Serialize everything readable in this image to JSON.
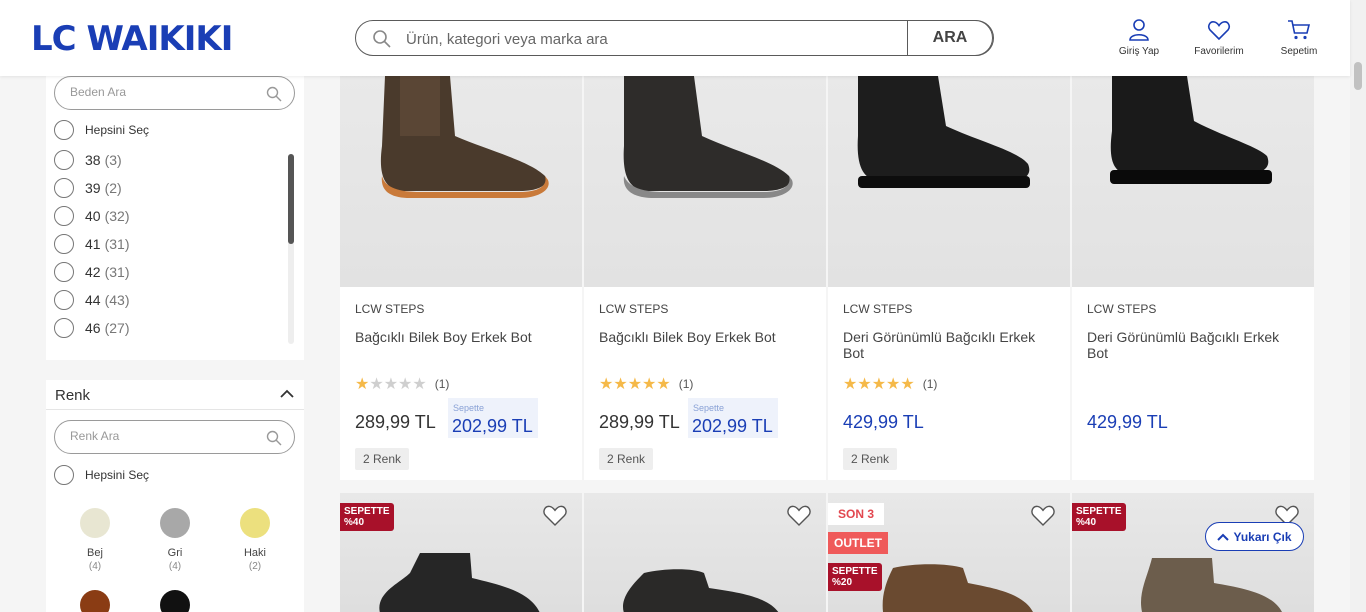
{
  "header": {
    "logo": "LC WAIKIKI",
    "search_placeholder": "Ürün, kategori veya marka ara",
    "search_button": "ARA",
    "login": "Giriş Yap",
    "favorites": "Favorilerim",
    "cart": "Sepetim"
  },
  "sidebar": {
    "size_search_placeholder": "Beden Ara",
    "size_select_all": "Hepsini Seç",
    "sizes": [
      {
        "label": "38",
        "count": "(3)"
      },
      {
        "label": "39",
        "count": "(2)"
      },
      {
        "label": "40",
        "count": "(32)"
      },
      {
        "label": "41",
        "count": "(31)"
      },
      {
        "label": "42",
        "count": "(31)"
      },
      {
        "label": "44",
        "count": "(43)"
      },
      {
        "label": "46",
        "count": "(27)"
      }
    ],
    "color_title": "Renk",
    "color_search_placeholder": "Renk Ara",
    "color_select_all": "Hepsini Seç",
    "colors": [
      {
        "name": "Bej",
        "count": "(4)",
        "hex": "#e8e6d2"
      },
      {
        "name": "Gri",
        "count": "(4)",
        "hex": "#a8a8a8"
      },
      {
        "name": "Haki",
        "count": "(2)",
        "hex": "#ece07e"
      },
      {
        "name": "",
        "count": "",
        "hex": "#8a3c14"
      },
      {
        "name": "",
        "count": "",
        "hex": "#111111"
      }
    ]
  },
  "products": [
    {
      "brand": "LCW STEPS",
      "name": "Bağcıklı Bilek Boy Erkek Bot",
      "rating": 1,
      "rating_count": "(1)",
      "price": "289,99 TL",
      "basket_label": "Sepette",
      "basket_price": "202,99 TL",
      "colors": "2 Renk"
    },
    {
      "brand": "LCW STEPS",
      "name": "Bağcıklı Bilek Boy Erkek Bot",
      "rating": 5,
      "rating_count": "(1)",
      "price": "289,99 TL",
      "basket_label": "Sepette",
      "basket_price": "202,99 TL",
      "colors": "2 Renk"
    },
    {
      "brand": "LCW STEPS",
      "name": "Deri Görünümlü Bağcıklı Erkek Bot",
      "rating": 5,
      "rating_count": "(1)",
      "price": "429,99 TL",
      "colors": "2 Renk"
    },
    {
      "brand": "LCW STEPS",
      "name": "Deri Görünümlü Bağcıklı Erkek Bot",
      "price": "429,99 TL"
    }
  ],
  "row2_badges": {
    "c1": "SEPETTE\n%40",
    "c3_son": "SON 3",
    "c3_outlet": "OUTLET",
    "c3_sepette": "SEPETTE\n%20",
    "c4": "SEPETTE\n%40"
  },
  "scroll_top": "Yukarı Çık",
  "colors": {
    "brand_blue": "#1a3eb5",
    "badge_red": "#a8112a",
    "outlet_red": "#ef5a5a",
    "star": "#f5b949"
  }
}
